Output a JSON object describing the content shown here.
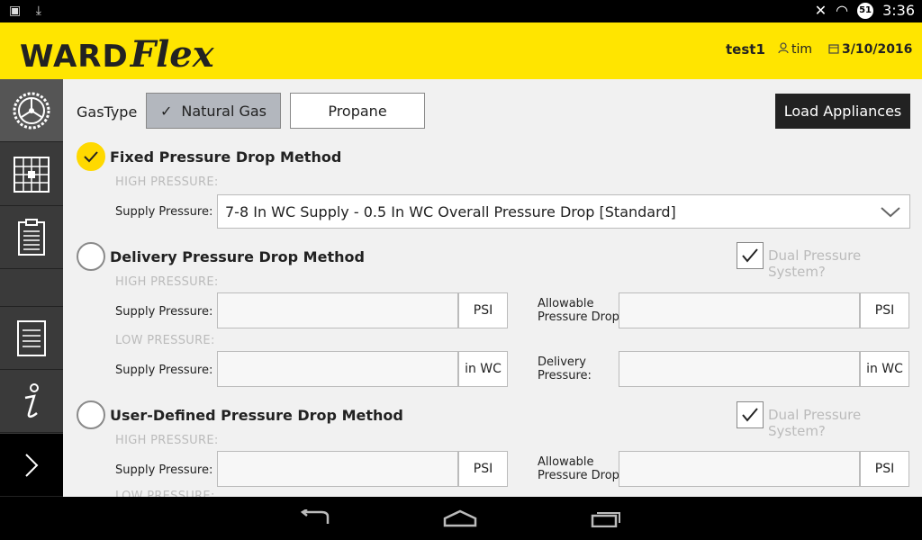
{
  "status_bar": {
    "time": "3:36",
    "battery": "51"
  },
  "header": {
    "logo_ward": "WARD",
    "logo_flex": "Flex",
    "project": "test1",
    "user": "tim",
    "date": "3/10/2016"
  },
  "gastype": {
    "label": "GasType",
    "options": [
      "Natural Gas",
      "Propane"
    ],
    "selected_check": "✓"
  },
  "load_button": "Load Appliances",
  "fixed": {
    "title": "Fixed Pressure Drop Method",
    "section": "HIGH PRESSURE:",
    "supply_label": "Supply Pressure:",
    "supply_value": "7-8 In WC Supply - 0.5 In WC Overall Pressure Drop [Standard]"
  },
  "delivery": {
    "title": "Delivery Pressure Drop Method",
    "dual_label": "Dual Pressure System?",
    "high_section": "HIGH PRESSURE:",
    "low_section": "LOW PRESSURE:",
    "supply_label": "Supply Pressure:",
    "allowable_label_1": "Allowable",
    "allowable_label_2": "Pressure Drop:",
    "delivery_label_1": "Delivery",
    "delivery_label_2": "Pressure:",
    "unit_psi": "PSI",
    "unit_inwc": "in WC"
  },
  "user_defined": {
    "title": "User-Defined Pressure Drop Method",
    "dual_label": "Dual Pressure System?",
    "high_section": "HIGH PRESSURE:",
    "low_section": "LOW PRESSURE:",
    "supply_label": "Supply Pressure:",
    "allowable_label_1": "Allowable",
    "allowable_label_2": "Pressure Drop:",
    "unit_psi": "PSI"
  }
}
